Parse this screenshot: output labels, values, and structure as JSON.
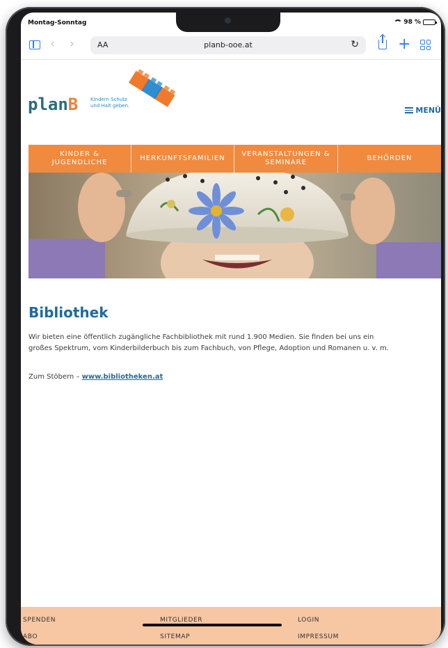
{
  "statusbar": {
    "carrier": "Montag-Sonntag",
    "battery": "98 %",
    "battery_level": 0.98
  },
  "browser": {
    "text_size_label": "AA",
    "url": "planb-ooe.at",
    "icons": [
      "sidebar-icon",
      "back-icon",
      "forward-icon",
      "reload-icon",
      "share-icon",
      "plus-icon",
      "tabs-icon"
    ]
  },
  "header": {
    "logo_prefix": "plan",
    "logo_suffix": "B",
    "tagline_line1": "Kindern Schutz",
    "tagline_line2": "und Halt geben.",
    "menu_label": "MENÜ"
  },
  "nav": {
    "items": [
      {
        "label": "KINDER & JUGENDLICHE"
      },
      {
        "label": "HERKUNFTSFAMILIEN"
      },
      {
        "label": "VERANSTALTUNGEN & SEMINARE"
      },
      {
        "label": "BEHÖRDEN"
      }
    ]
  },
  "main": {
    "title": "Bibliothek",
    "paragraph": "Wir bieten eine öffentlich zugängliche Fachbibliothek mit rund 1.900 Medien. Sie finden bei uns ein großes Spektrum, vom Kinderbilderbuch bis zum Fachbuch, von Pflege, Adoption und Romanen u. v. m.",
    "link_prefix": "Zum Stöbern – ",
    "link_text": "www.bibliotheken.at"
  },
  "footer": {
    "col1": [
      "SPENDEN",
      "ABO"
    ],
    "col2": [
      "MITGLIEDER",
      "SITEMAP"
    ],
    "col3": [
      "LOGIN",
      "IMPRESSUM"
    ]
  },
  "colors": {
    "nav_bg": "#f08a3f",
    "footer_bg": "#f7c6a3",
    "heading": "#1f6aa0",
    "link": "#1f6aa0",
    "browser_accent": "#2f7cf6"
  }
}
